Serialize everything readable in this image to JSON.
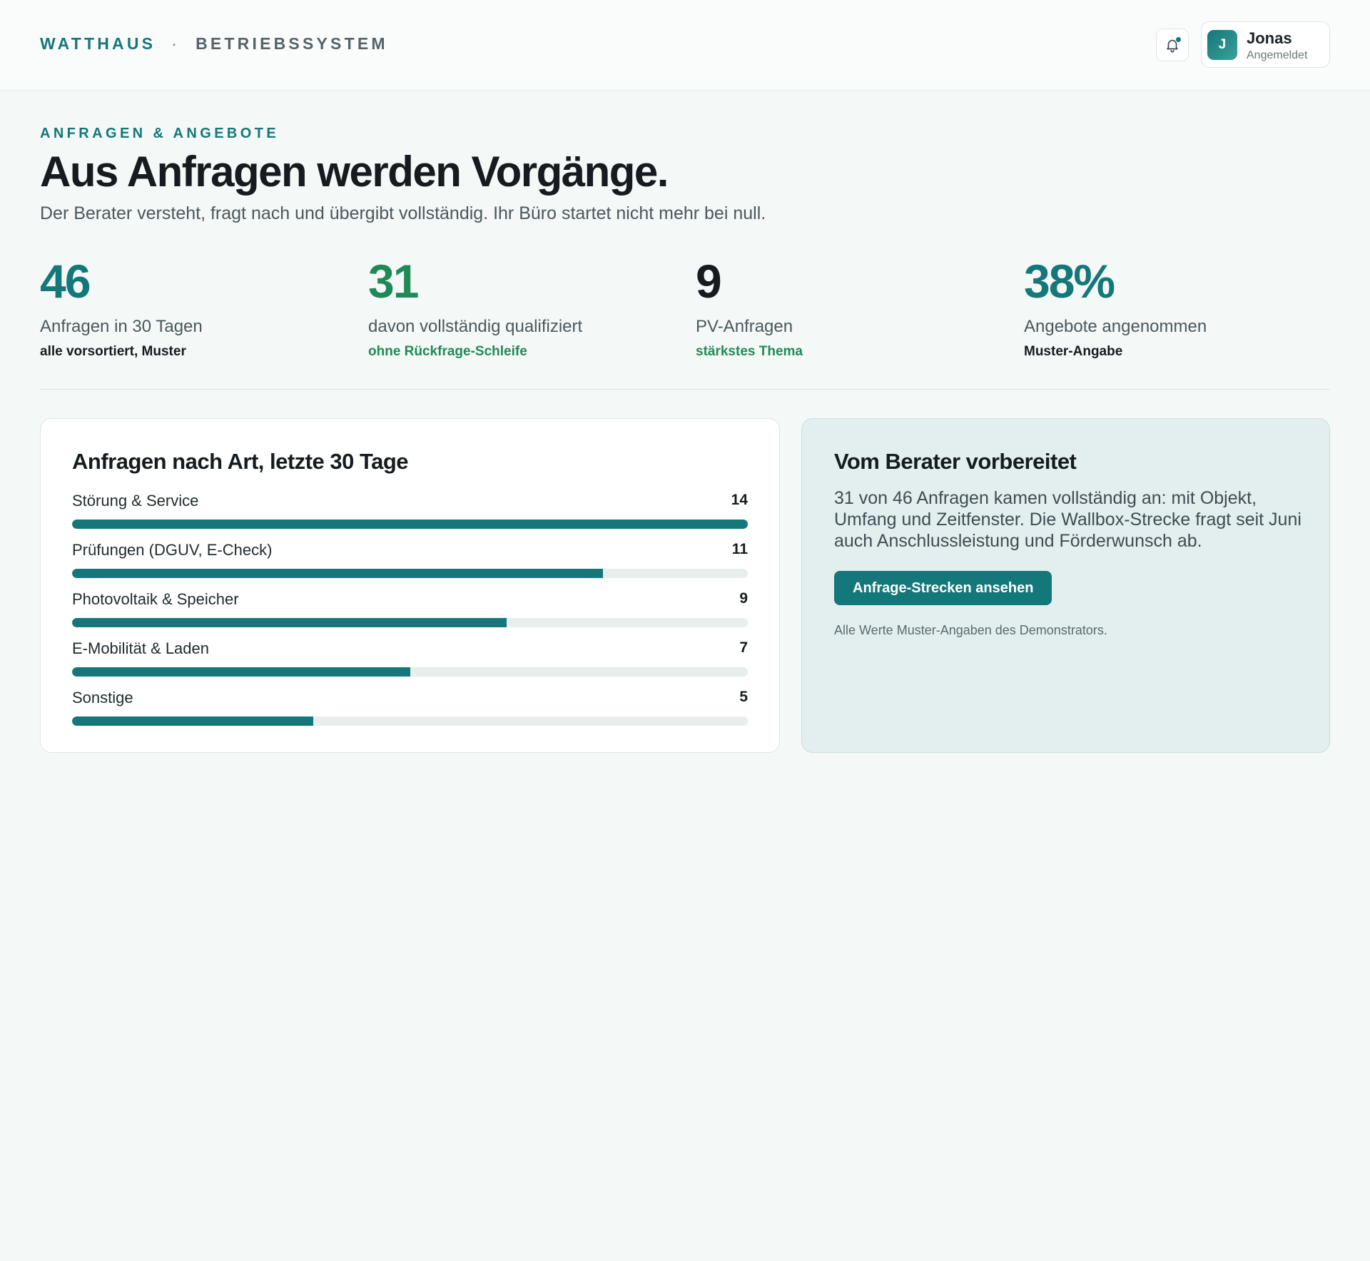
{
  "header": {
    "brand": "WATTHAUS",
    "separator": "·",
    "product": "BETRIEBSSYSTEM",
    "notifications_icon": "bell-icon",
    "user": {
      "initial": "J",
      "name": "Jonas",
      "status": "Angemeldet"
    }
  },
  "hero": {
    "eyebrow": "ANFRAGEN & ANGEBOTE",
    "title": "Aus Anfragen werden Vorgänge.",
    "lead": "Der Berater versteht, fragt nach und übergibt vollständig. Ihr Büro startet nicht mehr bei null."
  },
  "kpis": [
    {
      "value": "46",
      "label": "Anfragen in 30 Tagen",
      "note": "alle vorsortiert, Muster",
      "value_color": "#14777a",
      "note_color": "#151b1e"
    },
    {
      "value": "31",
      "label": "davon vollständig qualifiziert",
      "note": "ohne Rückfrage-Schleife",
      "value_color": "#1f8a57",
      "note_color": "#1f8a57"
    },
    {
      "value": "9",
      "label": "PV-Anfragen",
      "note": "stärkstes Thema",
      "value_color": "#151b1e",
      "note_color": "#1f8a57"
    },
    {
      "value": "38%",
      "label": "Angebote angenommen",
      "note": "Muster-Angabe",
      "value_color": "#14777a",
      "note_color": "#151b1e"
    }
  ],
  "chart": {
    "title": "Anfragen nach Art, letzte 30 Tage"
  },
  "chart_data": {
    "type": "bar",
    "title": "Anfragen nach Art, letzte 30 Tage",
    "orientation": "horizontal",
    "categories": [
      "Störung & Service",
      "Prüfungen (DGUV, E-Check)",
      "Photovoltaik & Speicher",
      "E-Mobilität & Laden",
      "Sonstige"
    ],
    "values": [
      14,
      11,
      9,
      7,
      5
    ],
    "xlim": [
      0,
      14
    ],
    "bar_color": "#14777a",
    "grid": false
  },
  "info": {
    "title": "Vom Berater vorbereitet",
    "text": "31 von 46 Anfragen kamen vollständig an: mit Objekt, Umfang und Zeitfenster. Die Wallbox-Strecke fragt seit Juni auch Anschlussleistung und Förderwunsch ab.",
    "button_label": "Anfrage-Strecken ansehen",
    "footnote": "Alle Werte Muster-Angaben des Demonstrators."
  },
  "colors": {
    "accent": "#14777a",
    "positive": "#1f8a57",
    "background": "#f4f8f7",
    "info_card": "#e2efee"
  }
}
